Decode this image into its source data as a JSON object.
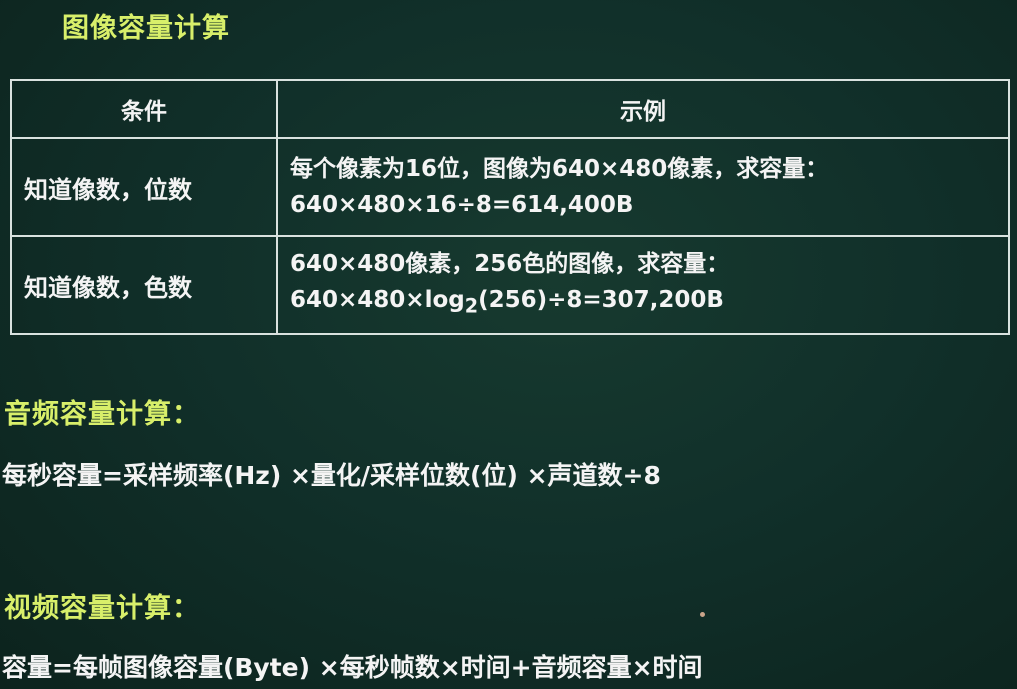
{
  "image_section": {
    "title": "图像容量计算",
    "table": {
      "headers": [
        "条件",
        "示例"
      ],
      "rows": [
        {
          "condition": "知道像数，位数",
          "example_line1": "每个像素为16位，图像为640×480像素，求容量：",
          "example_line2": "640×480×16÷8=614,400B"
        },
        {
          "condition": "知道像数，色数",
          "example_line1": "640×480像素，256色的图像，求容量：",
          "example_line2_pre": "640×480×log",
          "example_line2_sub": "2",
          "example_line2_post": "(256)÷8=307,200B"
        }
      ]
    }
  },
  "audio_section": {
    "title": "音频容量计算：",
    "formula": "每秒容量=采样频率(Hz) ×量化/采样位数(位) ×声道数÷8"
  },
  "video_section": {
    "title": "视频容量计算：",
    "formula": "容量=每帧图像容量(Byte) ×每秒帧数×时间+音频容量×时间"
  }
}
